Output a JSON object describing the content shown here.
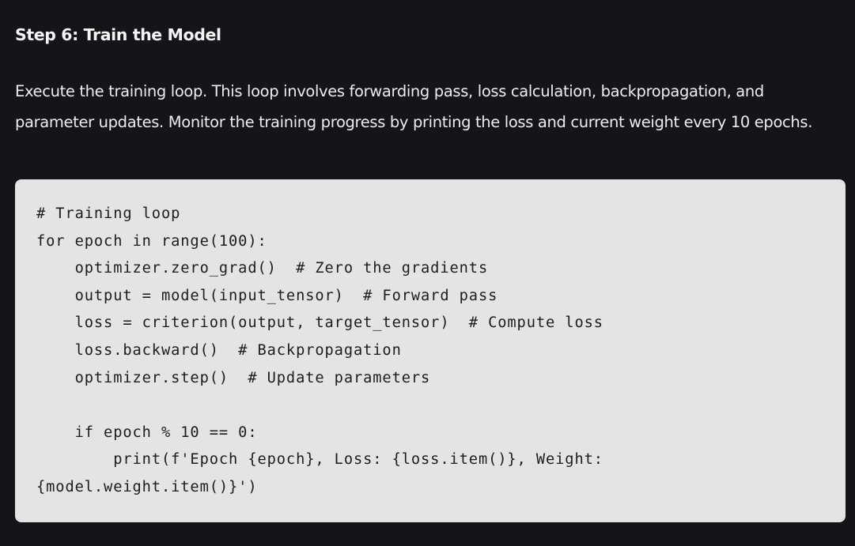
{
  "section": {
    "heading": "Step 6: Train the Model",
    "paragraph": "Execute the training loop. This loop involves forwarding pass, loss calculation, backpropagation, and parameter updates. Monitor the training progress by printing the loss and current weight every 10 epochs."
  },
  "code": {
    "language": "python",
    "lines": [
      "# Training loop",
      "for epoch in range(100):",
      "    optimizer.zero_grad()  # Zero the gradients",
      "    output = model(input_tensor)  # Forward pass",
      "    loss = criterion(output, target_tensor)  # Compute loss",
      "    loss.backward()  # Backpropagation",
      "    optimizer.step()  # Update parameters",
      "",
      "    if epoch % 10 == 0:",
      "        print(f'Epoch {epoch}, Loss: {loss.item()}, Weight:",
      "{model.weight.item()}')"
    ]
  },
  "colors": {
    "page_background": "#141518",
    "text": "#ececf1",
    "code_background": "#e4e4e4",
    "code_text": "#1d1d1f"
  }
}
